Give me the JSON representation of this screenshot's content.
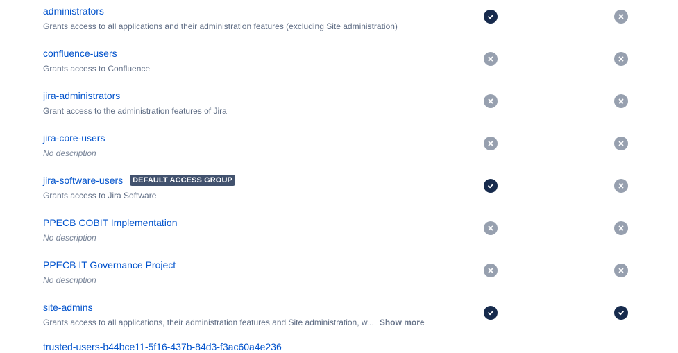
{
  "groups": [
    {
      "name": "administrators",
      "description": "Grants access to all applications and their administration features (excluding Site administration)",
      "no_description": false,
      "badge": "",
      "show_more": "",
      "col1": "on",
      "col2": "off"
    },
    {
      "name": "confluence-users",
      "description": "Grants access to Confluence",
      "no_description": false,
      "badge": "",
      "show_more": "",
      "col1": "off",
      "col2": "off"
    },
    {
      "name": "jira-administrators",
      "description": "Grant access to the administration features of Jira",
      "no_description": false,
      "badge": "",
      "show_more": "",
      "col1": "off",
      "col2": "off"
    },
    {
      "name": "jira-core-users",
      "description": "No description",
      "no_description": true,
      "badge": "",
      "show_more": "",
      "col1": "off",
      "col2": "off"
    },
    {
      "name": "jira-software-users",
      "description": "Grants access to Jira Software",
      "no_description": false,
      "badge": "DEFAULT ACCESS GROUP",
      "show_more": "",
      "col1": "on",
      "col2": "off"
    },
    {
      "name": "PPECB COBIT Implementation",
      "description": "No description",
      "no_description": true,
      "badge": "",
      "show_more": "",
      "col1": "off",
      "col2": "off"
    },
    {
      "name": "PPECB IT Governance Project",
      "description": "No description",
      "no_description": true,
      "badge": "",
      "show_more": "",
      "col1": "off",
      "col2": "off"
    },
    {
      "name": "site-admins",
      "description": "Grants access to all applications, their administration features and Site administration, w...",
      "no_description": false,
      "badge": "",
      "show_more": "Show more",
      "col1": "on",
      "col2": "on"
    }
  ],
  "partial_row": {
    "name": "trusted-users-b44bce11-5f16-437b-84d3-f3ac60a4e236"
  },
  "colors": {
    "link": "#0052cc",
    "on": "#172b4d",
    "off": "#97a0af",
    "badge": "#42526e"
  },
  "icons": {
    "on": "checkmark-icon",
    "off": "cross-icon"
  }
}
